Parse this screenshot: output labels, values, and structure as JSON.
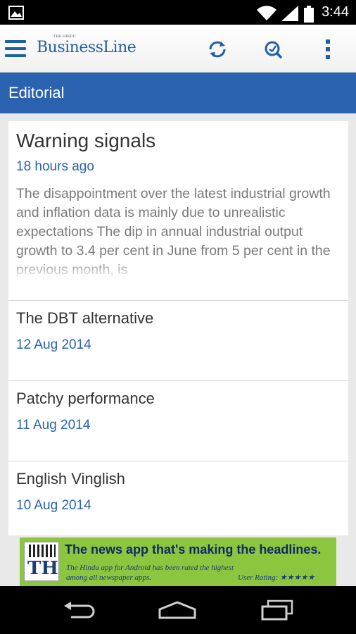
{
  "status_bar": {
    "time": "3:44",
    "icons": [
      "image-icon",
      "wifi-icon",
      "signal-icon",
      "battery-icon"
    ]
  },
  "app_bar": {
    "logo_text": "BusinessLine",
    "logo_tag": "THE HINDU",
    "icons": [
      "menu-icon",
      "refresh-icon",
      "search-icon",
      "overflow-menu-icon"
    ]
  },
  "section": {
    "title": "Editorial"
  },
  "articles": [
    {
      "title": "Warning signals",
      "date": "18 hours ago",
      "summary": "The disappointment over the latest industrial growth and inflation data is mainly due to unrealistic expectations The dip in annual industrial output growth to 3.4 per cent in June from 5 per cent in the previous month, is"
    },
    {
      "title": "The DBT alternative",
      "date": "12 Aug 2014"
    },
    {
      "title": "Patchy performance",
      "date": "11 Aug 2014"
    },
    {
      "title": "English Vinglish",
      "date": "10 Aug 2014"
    }
  ],
  "ad": {
    "logo": "TH",
    "headline": "The news app that's making the headlines.",
    "sub": "The Hindu app for Android has been rated the highest among all newspaper apps.",
    "rating": "User Rating: ★★★★★"
  },
  "nav_bar": {
    "icons": [
      "back-icon",
      "home-icon",
      "recent-apps-icon"
    ]
  },
  "colors": {
    "accent": "#2a62b0",
    "ad_background": "#8cc63f"
  }
}
